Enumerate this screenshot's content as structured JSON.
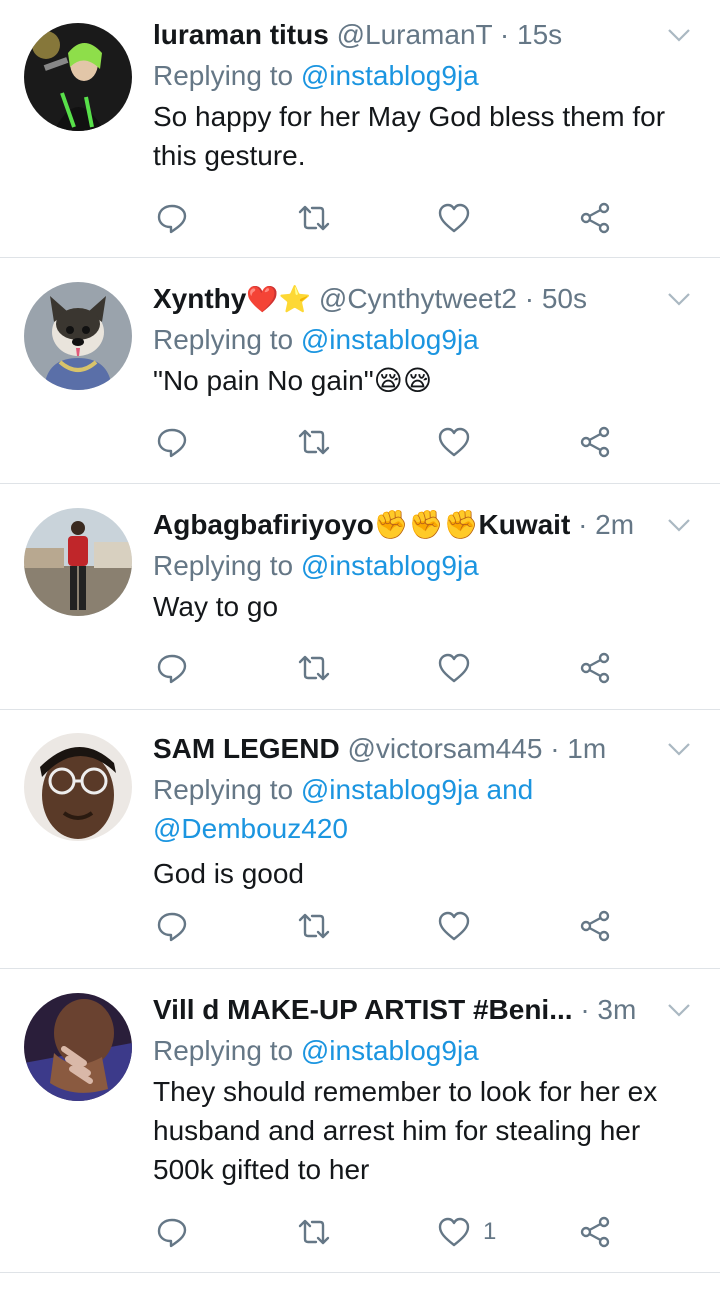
{
  "tweets": [
    {
      "name": "luraman titus",
      "handle": "@LuramanT",
      "time": "· 15s",
      "replying_prefix": "Replying to ",
      "replying_to": "@instablog9ja",
      "text_lines": [
        "So happy for her May God bless them for",
        "this gesture."
      ],
      "like_count": ""
    },
    {
      "name": "Xynthy",
      "name_emoji": "❤️⭐",
      "handle": "@Cynthytweet2",
      "time": "· 50s",
      "replying_prefix": "Replying to ",
      "replying_to": "@instablog9ja",
      "text_lines": [
        "\"No pain No gain\"😪😪"
      ],
      "like_count": ""
    },
    {
      "name": "Agbagbafiriyoyo✊✊✊Kuwait",
      "handle": "",
      "time": "· 2m",
      "replying_prefix": "Replying to ",
      "replying_to": "@instablog9ja",
      "text_lines": [
        "Way to go"
      ],
      "like_count": ""
    },
    {
      "name": "SAM LEGEND",
      "handle": "@victorsam445",
      "time": "· 1m",
      "replying_prefix": "Replying to ",
      "replying_to": "@instablog9ja and",
      "replying_to_2": "@Dembouz420",
      "text_lines": [
        "God is good"
      ],
      "like_count": ""
    },
    {
      "name": "Vill d MAKE-UP ARTIST #Beni...",
      "handle": "",
      "time": "· 3m",
      "replying_prefix": "Replying to ",
      "replying_to": "@instablog9ja",
      "text_lines": [
        "They should remember to look for her ex",
        "husband and arrest him for stealing her",
        "500k gifted to her"
      ],
      "like_count": "1"
    }
  ],
  "icons": {
    "reply": "reply-icon",
    "retweet": "retweet-icon",
    "like": "heart-icon",
    "share": "share-icon",
    "more": "chevron-down-icon"
  },
  "colors": {
    "link": "#1b95e0",
    "secondary": "#657786",
    "divider": "#dfe3e7"
  }
}
